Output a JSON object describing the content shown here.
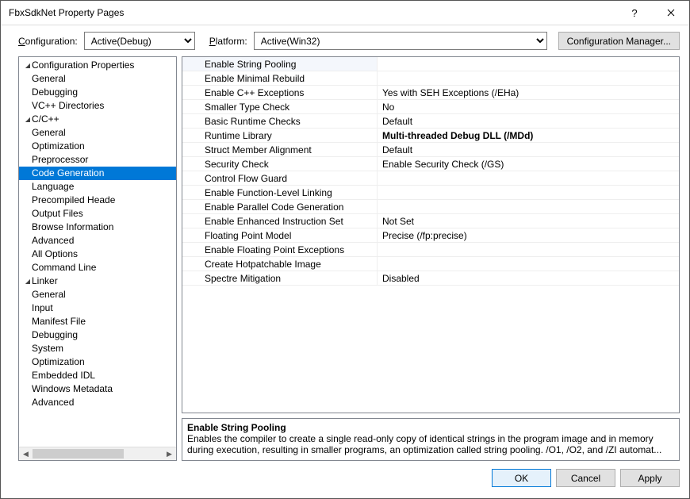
{
  "window": {
    "title": "FbxSdkNet Property Pages"
  },
  "toolbar": {
    "config_label": "Configuration:",
    "config_value": "Active(Debug)",
    "platform_label": "Platform:",
    "platform_value": "Active(Win32)",
    "config_mgr": "Configuration Manager..."
  },
  "tree": {
    "root": "Configuration Properties",
    "items": [
      "General",
      "Debugging",
      "VC++ Directories"
    ],
    "cc": {
      "label": "C/C++",
      "items": [
        "General",
        "Optimization",
        "Preprocessor",
        "Code Generation",
        "Language",
        "Precompiled Heade",
        "Output Files",
        "Browse Information",
        "Advanced",
        "All Options",
        "Command Line"
      ]
    },
    "linker": {
      "label": "Linker",
      "items": [
        "General",
        "Input",
        "Manifest File",
        "Debugging",
        "System",
        "Optimization",
        "Embedded IDL",
        "Windows Metadata",
        "Advanced"
      ]
    }
  },
  "grid": [
    {
      "name": "Enable String Pooling",
      "value": "",
      "selected": true
    },
    {
      "name": "Enable Minimal Rebuild",
      "value": ""
    },
    {
      "name": "Enable C++ Exceptions",
      "value": "Yes with SEH Exceptions (/EHa)"
    },
    {
      "name": "Smaller Type Check",
      "value": "No"
    },
    {
      "name": "Basic Runtime Checks",
      "value": "Default"
    },
    {
      "name": "Runtime Library",
      "value": "Multi-threaded Debug DLL (/MDd)",
      "bold": true
    },
    {
      "name": "Struct Member Alignment",
      "value": "Default"
    },
    {
      "name": "Security Check",
      "value": "Enable Security Check (/GS)"
    },
    {
      "name": "Control Flow Guard",
      "value": ""
    },
    {
      "name": "Enable Function-Level Linking",
      "value": ""
    },
    {
      "name": "Enable Parallel Code Generation",
      "value": ""
    },
    {
      "name": "Enable Enhanced Instruction Set",
      "value": "Not Set"
    },
    {
      "name": "Floating Point Model",
      "value": "Precise (/fp:precise)"
    },
    {
      "name": "Enable Floating Point Exceptions",
      "value": ""
    },
    {
      "name": "Create Hotpatchable Image",
      "value": ""
    },
    {
      "name": "Spectre Mitigation",
      "value": "Disabled"
    }
  ],
  "desc": {
    "title": "Enable String Pooling",
    "body": "Enables the compiler to create a single read-only copy of identical strings in the program image and in memory during execution, resulting in smaller programs, an optimization called string pooling. /O1, /O2, and /ZI  automat..."
  },
  "buttons": {
    "ok": "OK",
    "cancel": "Cancel",
    "apply": "Apply"
  }
}
